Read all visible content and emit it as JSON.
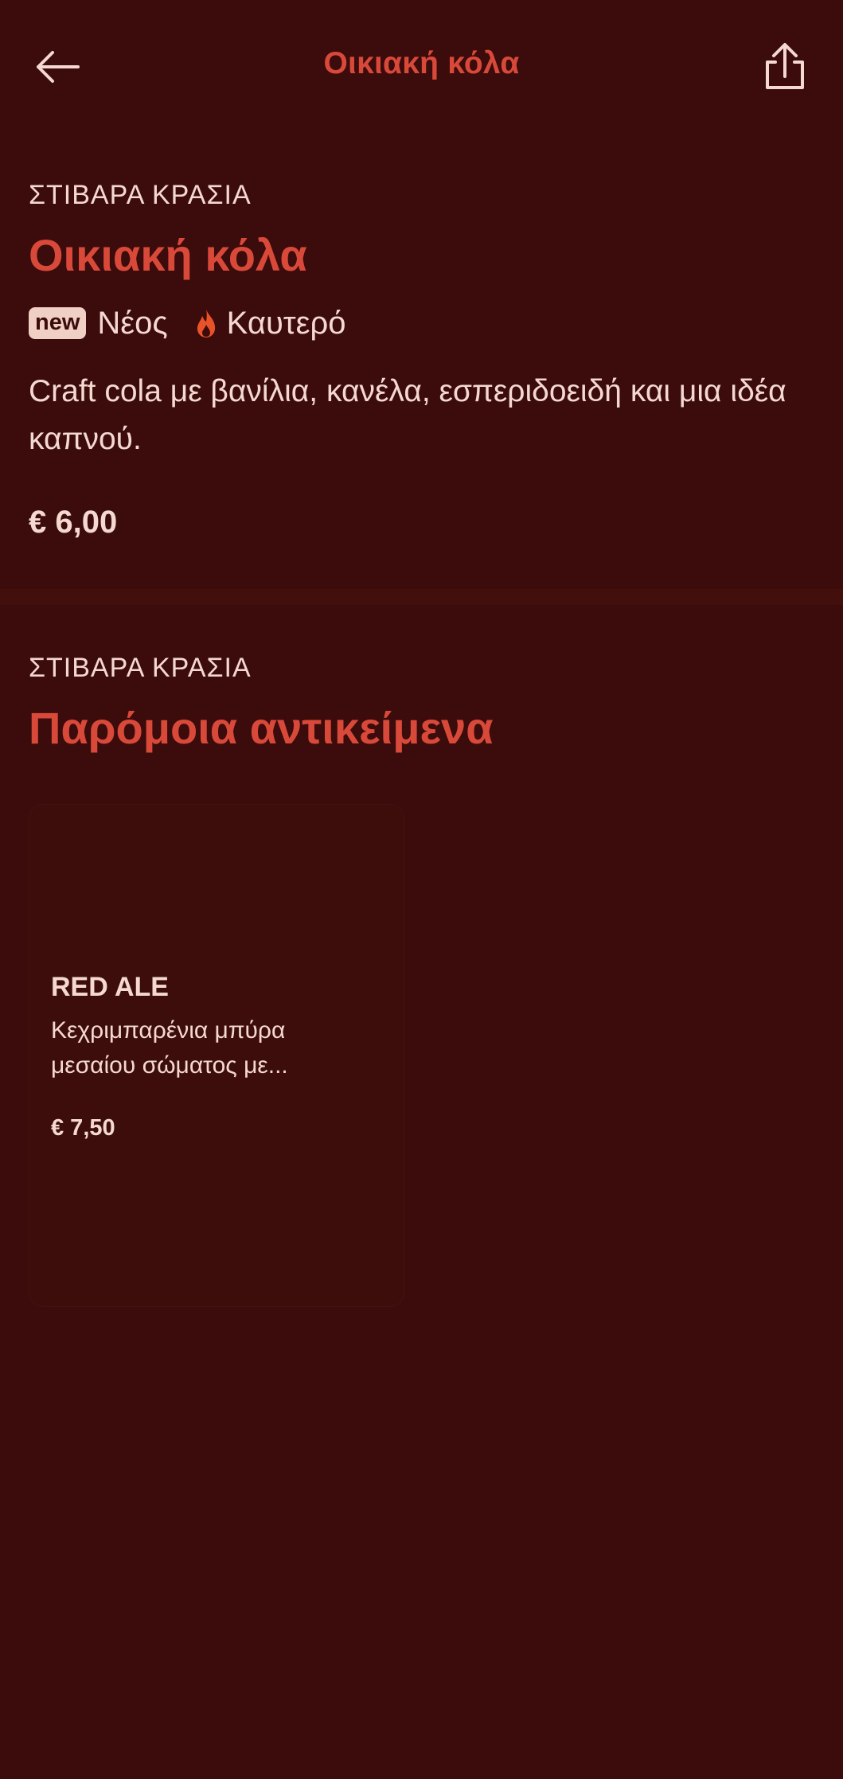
{
  "header": {
    "title": "Οικιακή κόλα",
    "back_icon": "arrow-left-icon",
    "share_icon": "share-icon"
  },
  "item": {
    "category": "ΣΤΙΒΑΡΑ ΚΡΑΣΙΑ",
    "title": "Οικιακή κόλα",
    "badge": "new",
    "tag_new": "Νέος",
    "tag_hot": "Καυτερό",
    "hot_icon": "fire-icon",
    "description": "Craft cola με βανίλια, κανέλα, εσπεριδοειδή και μια ιδέα καπνού.",
    "price": "€ 6,00"
  },
  "similar": {
    "category": "ΣΤΙΒΑΡΑ ΚΡΑΣΙΑ",
    "title": "Παρόμοια αντικείμενα",
    "items": [
      {
        "name": "RED ALE",
        "description": "Κεχριμπαρένια μπύρα μεσαίου σώματος με...",
        "price": "€ 7,50"
      }
    ]
  },
  "colors": {
    "background": "#3b0c0b",
    "accent": "#d9493a",
    "text": "#f5d9d0",
    "fire": "#e8532a"
  }
}
